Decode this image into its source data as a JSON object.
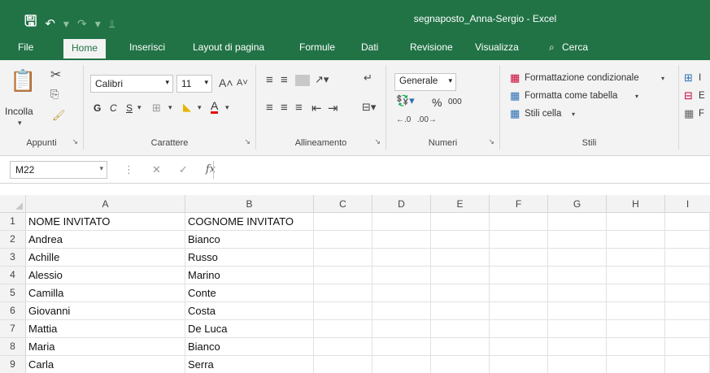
{
  "window": {
    "title": "segnaposto_Anna-Sergio  -  Excel"
  },
  "tabs": [
    "File",
    "Home",
    "Inserisci",
    "Layout di pagina",
    "Formule",
    "Dati",
    "Revisione",
    "Visualizza",
    "Cerca"
  ],
  "ribbon": {
    "clipboard": {
      "paste_label": "Incolla",
      "group_label": "Appunti"
    },
    "font": {
      "font_name": "Calibri",
      "font_size": "11",
      "bold": "G",
      "italic": "C",
      "underline": "S",
      "group_label": "Carattere"
    },
    "alignment": {
      "group_label": "Allineamento"
    },
    "number": {
      "format": "Generale",
      "percent": "%",
      "thousands": "000",
      "group_label": "Numeri"
    },
    "styles": {
      "conditional": "Formattazione condizionale",
      "as_table": "Formatta come tabella",
      "cell_styles": "Stili cella",
      "group_label": "Stili"
    },
    "cells": {
      "i1": "I",
      "i2": "E",
      "i3": "F"
    }
  },
  "formula_bar": {
    "name_box": "M22",
    "fx": "fx",
    "value": ""
  },
  "grid": {
    "columns": [
      "A",
      "B",
      "C",
      "D",
      "E",
      "F",
      "G",
      "H",
      "I"
    ],
    "rows": [
      {
        "n": "1",
        "a": "NOME INVITATO",
        "b": "COGNOME INVITATO"
      },
      {
        "n": "2",
        "a": "Andrea",
        "b": "Bianco"
      },
      {
        "n": "3",
        "a": "Achille",
        "b": "Russo"
      },
      {
        "n": "4",
        "a": "Alessio",
        "b": "Marino"
      },
      {
        "n": "5",
        "a": "Camilla",
        "b": "Conte"
      },
      {
        "n": "6",
        "a": "Giovanni",
        "b": "Costa"
      },
      {
        "n": "7",
        "a": "Mattia",
        "b": "De Luca"
      },
      {
        "n": "8",
        "a": "Maria",
        "b": "Bianco"
      },
      {
        "n": "9",
        "a": "Carla",
        "b": "Serra"
      }
    ]
  },
  "colors": {
    "excel_green": "#217346"
  }
}
